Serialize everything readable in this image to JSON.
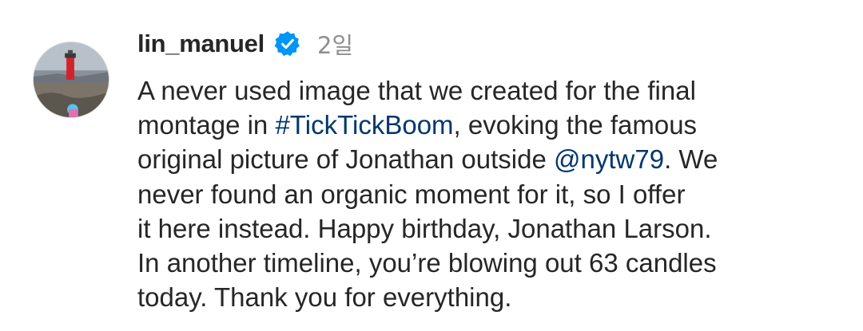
{
  "comment": {
    "username": "lin_manuel",
    "verified": true,
    "timestamp": "2일",
    "lines": [
      {
        "pre": "A never used image that we created for the final",
        "link": "",
        "post": ""
      },
      {
        "pre": "montage in ",
        "link": "#TickTickBoom",
        "post": ", evoking the famous"
      },
      {
        "pre": "original picture of Jonathan outside ",
        "link": "@nytw79",
        "post": ". We"
      },
      {
        "pre": "never found an organic moment for it, so I offer",
        "link": "",
        "post": ""
      },
      {
        "pre": "it here instead. Happy birthday, Jonathan Larson.",
        "link": "",
        "post": ""
      },
      {
        "pre": "In another timeline, you’re blowing out 63 candles",
        "link": "",
        "post": ""
      },
      {
        "pre": "today. Thank you for everything.",
        "link": "",
        "post": ""
      }
    ]
  },
  "icons": {
    "avatar": "lighthouse-photo-avatar",
    "verified": "verified-badge-icon"
  },
  "colors": {
    "link": "#00376b",
    "verified": "#0095f6",
    "text": "#262626",
    "muted": "#8e8e8e"
  }
}
